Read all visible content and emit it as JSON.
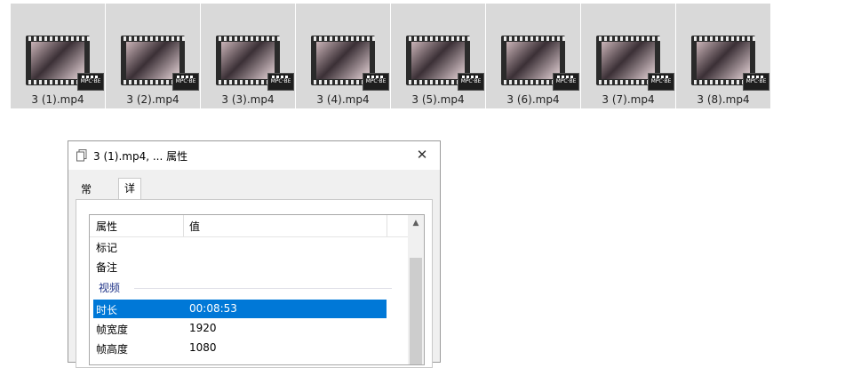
{
  "files": [
    {
      "name": "3 (1).mp4"
    },
    {
      "name": "3 (2).mp4"
    },
    {
      "name": "3 (3).mp4"
    },
    {
      "name": "3 (4).mp4"
    },
    {
      "name": "3 (5).mp4"
    },
    {
      "name": "3 (6).mp4"
    },
    {
      "name": "3 (7).mp4"
    },
    {
      "name": "3 (8).mp4"
    }
  ],
  "badge_text": "MPC·BE",
  "dialog": {
    "title": "3 (1).mp4, ... 属性",
    "close_glyph": "✕",
    "tabs": {
      "general": "常规",
      "details": "详细信息"
    },
    "columns": {
      "property": "属性",
      "value": "值"
    },
    "rows_top": [
      {
        "key": "标记",
        "value": ""
      },
      {
        "key": "备注",
        "value": ""
      }
    ],
    "group_label": "视频",
    "rows_video": [
      {
        "key": "时长",
        "value": "00:08:53",
        "selected": true
      },
      {
        "key": "帧宽度",
        "value": "1920"
      },
      {
        "key": "帧高度",
        "value": "1080"
      }
    ],
    "scroll_up_glyph": "▲",
    "accent_color": "#0078d7"
  }
}
